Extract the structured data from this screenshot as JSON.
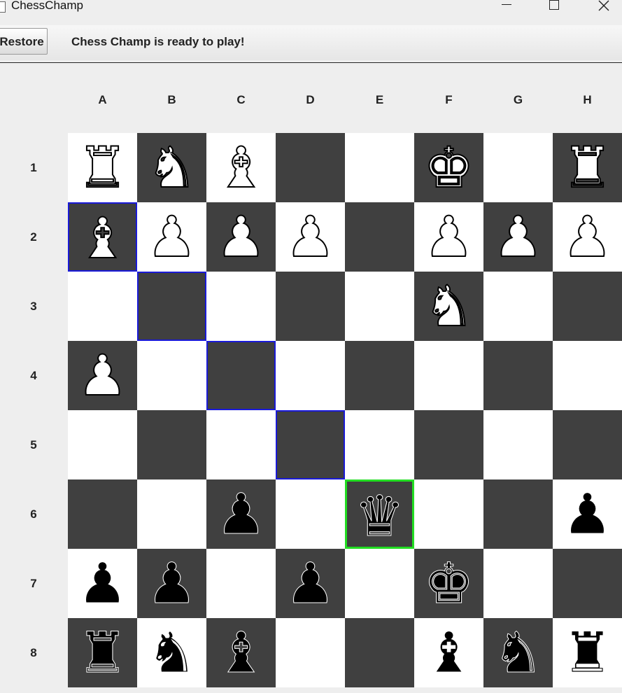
{
  "window": {
    "title": "ChessChamp",
    "minimize": "—",
    "maximize": "☐",
    "close": "✕"
  },
  "toolbar": {
    "restore_label": "Restore",
    "status": "Chess Champ is ready to play!"
  },
  "board": {
    "columns": [
      "A",
      "B",
      "C",
      "D",
      "E",
      "F",
      "G",
      "H"
    ],
    "rows": [
      "1",
      "2",
      "3",
      "4",
      "5",
      "6",
      "7",
      "8"
    ],
    "pieces": {
      "A1": {
        "glyph": "♜",
        "side": "white",
        "name": "rook"
      },
      "B1": {
        "glyph": "♞",
        "side": "white",
        "name": "knight"
      },
      "C1": {
        "glyph": "♝",
        "side": "white",
        "name": "bishop"
      },
      "F1": {
        "glyph": "♚",
        "side": "white",
        "name": "king"
      },
      "H1": {
        "glyph": "♜",
        "side": "white",
        "name": "rook"
      },
      "A2": {
        "glyph": "♝",
        "side": "white",
        "name": "bishop"
      },
      "B2": {
        "glyph": "♟",
        "side": "white",
        "name": "pawn"
      },
      "C2": {
        "glyph": "♟",
        "side": "white",
        "name": "pawn"
      },
      "D2": {
        "glyph": "♟",
        "side": "white",
        "name": "pawn"
      },
      "F2": {
        "glyph": "♟",
        "side": "white",
        "name": "pawn"
      },
      "G2": {
        "glyph": "♟",
        "side": "white",
        "name": "pawn"
      },
      "H2": {
        "glyph": "♟",
        "side": "white",
        "name": "pawn"
      },
      "F3": {
        "glyph": "♞",
        "side": "white",
        "name": "knight"
      },
      "A4": {
        "glyph": "♟",
        "side": "white",
        "name": "pawn"
      },
      "C6": {
        "glyph": "♟",
        "side": "black",
        "name": "pawn"
      },
      "E6": {
        "glyph": "♛",
        "side": "black",
        "name": "queen"
      },
      "H6": {
        "glyph": "♟",
        "side": "black",
        "name": "pawn"
      },
      "A7": {
        "glyph": "♟",
        "side": "black",
        "name": "pawn"
      },
      "B7": {
        "glyph": "♟",
        "side": "black",
        "name": "pawn"
      },
      "D7": {
        "glyph": "♟",
        "side": "black",
        "name": "pawn"
      },
      "F7": {
        "glyph": "♚",
        "side": "black",
        "name": "king"
      },
      "A8": {
        "glyph": "♜",
        "side": "black",
        "name": "rook"
      },
      "B8": {
        "glyph": "♞",
        "side": "black",
        "name": "knight"
      },
      "C8": {
        "glyph": "♝",
        "side": "black",
        "name": "bishop"
      },
      "F8": {
        "glyph": "♝",
        "side": "black",
        "name": "bishop"
      },
      "G8": {
        "glyph": "♞",
        "side": "black",
        "name": "knight"
      },
      "H8": {
        "glyph": "♜",
        "side": "black",
        "name": "rook"
      }
    },
    "highlight_blue": [
      "A2",
      "B3",
      "C4",
      "D5"
    ],
    "highlight_green": [
      "E6"
    ],
    "colors": {
      "light": "#ffffff",
      "dark": "#404040",
      "blue": "#1a1ad8",
      "green": "#22dd22"
    }
  }
}
